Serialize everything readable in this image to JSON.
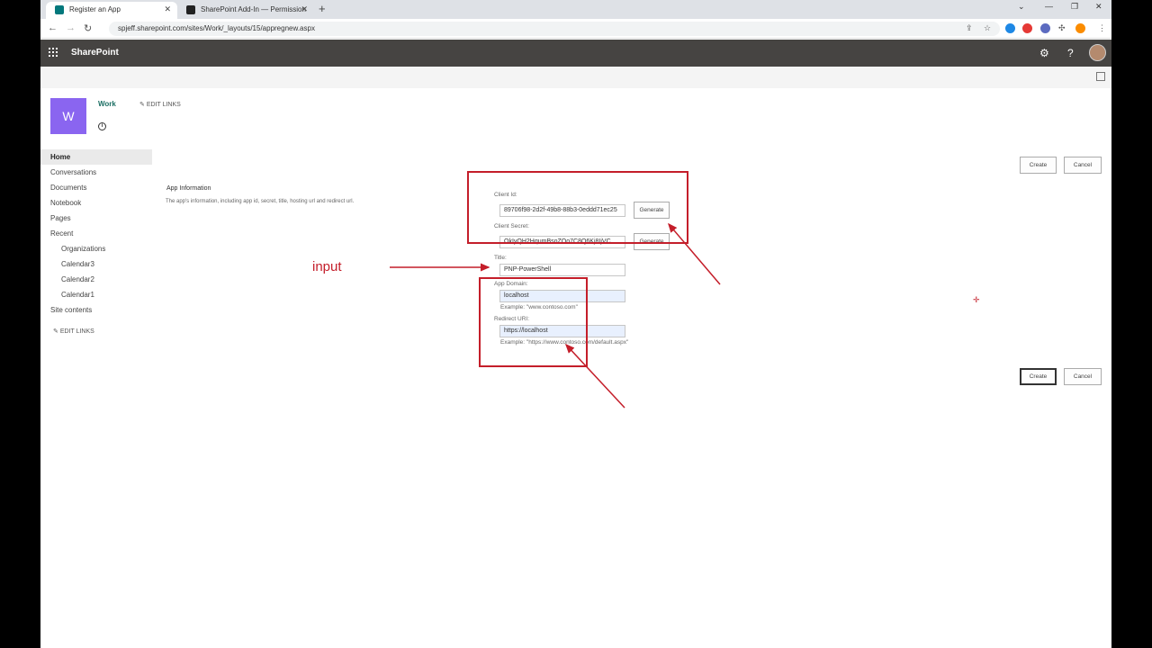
{
  "browser": {
    "tabs": [
      {
        "title": "Register an App",
        "active": true
      },
      {
        "title": "SharePoint Add-In — Permission",
        "active": false
      }
    ],
    "url": "spjeff.sharepoint.com/sites/Work/_layouts/15/appregnew.aspx"
  },
  "suitebar": {
    "brand": "SharePoint"
  },
  "site": {
    "logo_letter": "W",
    "title": "Work",
    "edit_links": "EDIT LINKS"
  },
  "leftnav": {
    "items": [
      {
        "label": "Home"
      },
      {
        "label": "Conversations"
      },
      {
        "label": "Documents"
      },
      {
        "label": "Notebook"
      },
      {
        "label": "Pages"
      },
      {
        "label": "Recent"
      },
      {
        "label": "Organizations"
      },
      {
        "label": "Calendar3"
      },
      {
        "label": "Calendar2"
      },
      {
        "label": "Calendar1"
      },
      {
        "label": "Site contents"
      }
    ],
    "edit_links": "EDIT LINKS"
  },
  "form": {
    "section_title": "App Information",
    "section_desc": "The app's information, including app id, secret, title, hosting url and redirect url.",
    "client_id_label": "Client Id:",
    "client_id_value": "89706f98-2d2f-49b8-88b3-0eddd71ec25",
    "client_secret_label": "Client Secret:",
    "client_secret_value": "OkIyQH2HqumBsoZOo7C8Q6Kj8IjVC",
    "generate_label": "Generate",
    "title_label": "Title:",
    "title_value": "PNP-PowerShell",
    "app_domain_label": "App Domain:",
    "app_domain_value": "localhost",
    "app_domain_example": "Example: \"www.contoso.com\"",
    "redirect_label": "Redirect URI:",
    "redirect_value": "https://localhost",
    "redirect_example": "Example: \"https://www.contoso.com/default.aspx\"",
    "create_label": "Create",
    "cancel_label": "Cancel"
  },
  "annotation": {
    "text": "input",
    "color": "#c41e2a"
  }
}
